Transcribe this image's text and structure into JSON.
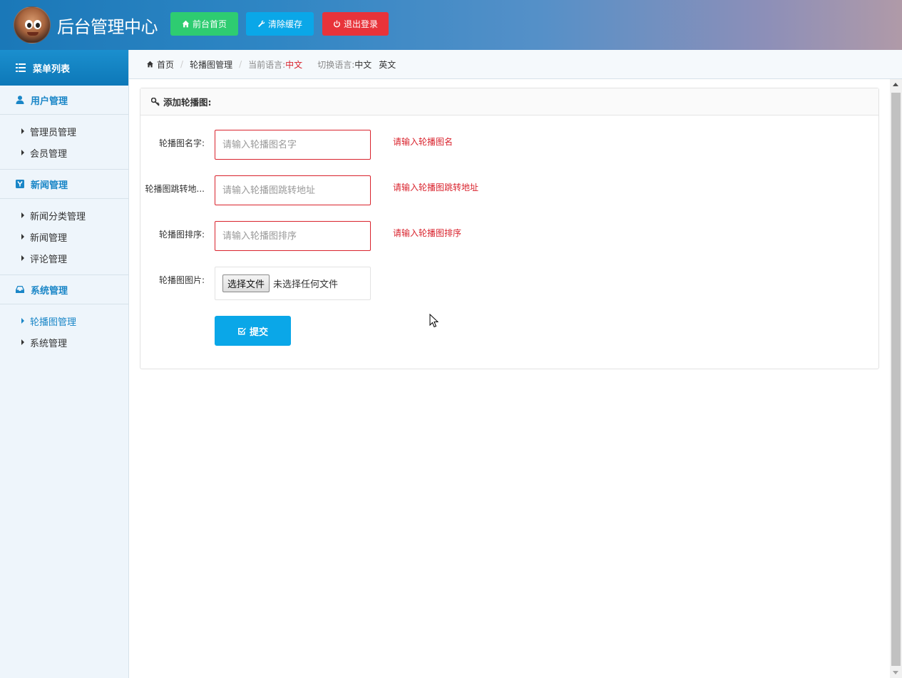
{
  "header": {
    "title": "后台管理中心",
    "buttons": [
      {
        "label": "前台首页",
        "icon": "home-icon",
        "color": "#2ecc71"
      },
      {
        "label": "清除缓存",
        "icon": "wrench-icon",
        "color": "#0aa7e8"
      },
      {
        "label": "退出登录",
        "icon": "power-icon",
        "color": "#e8333a"
      }
    ]
  },
  "sidebar": {
    "menu_title": "菜单列表",
    "groups": [
      {
        "title": "用户管理",
        "icon": "user-icon",
        "items": [
          "管理员管理",
          "会员管理"
        ]
      },
      {
        "title": "新闻管理",
        "icon": "news-icon",
        "items": [
          "新闻分类管理",
          "新闻管理",
          "评论管理"
        ]
      },
      {
        "title": "系统管理",
        "icon": "inbox-icon",
        "items": [
          "轮播图管理",
          "系统管理"
        ]
      }
    ],
    "active_item": "轮播图管理"
  },
  "breadcrumb": {
    "home": "首页",
    "current": "轮播图管理",
    "current_lang_label": "当前语言:",
    "current_lang": "中文",
    "switch_lang_label": "切换语言:",
    "lang_options": [
      "中文",
      "英文"
    ]
  },
  "form": {
    "panel_title": "添加轮播图:",
    "fields": [
      {
        "label": "轮播图名字:",
        "placeholder": "请输入轮播图名字",
        "value": "",
        "error": "请输入轮播图名"
      },
      {
        "label": "轮播图跳转地...",
        "placeholder": "请输入轮播图跳转地址",
        "value": "",
        "error": "请输入轮播图跳转地址"
      },
      {
        "label": "轮播图排序:",
        "placeholder": "请输入轮播图排序",
        "value": "",
        "error": "请输入轮播图排序"
      }
    ],
    "file_field": {
      "label": "轮播图图片:",
      "button": "选择文件",
      "status": "未选择任何文件"
    },
    "submit_label": "提交"
  },
  "colors": {
    "accent": "#1a86c7",
    "error": "#d9232d",
    "submit": "#0aa7e8"
  }
}
